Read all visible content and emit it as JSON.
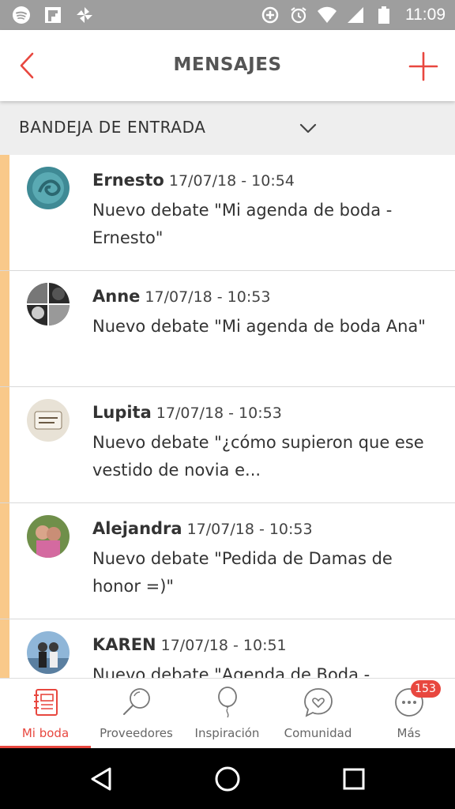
{
  "status_bar": {
    "time": "11:09",
    "left_icons": [
      "spotify-icon",
      "flipboard-icon",
      "pinwheel-icon"
    ],
    "right_icons": [
      "data-saver-icon",
      "alarm-icon",
      "wifi-icon",
      "signal-icon",
      "battery-icon"
    ]
  },
  "header": {
    "title": "MENSAJES",
    "back_icon": "chevron-left-icon",
    "add_icon": "plus-icon"
  },
  "inbox": {
    "selected": "BANDEJA DE ENTRADA"
  },
  "messages": [
    {
      "name": "Ernesto",
      "date": "17/07/18 - 10:54",
      "text": "Nuevo debate \"Mi agenda de boda - Ernesto\""
    },
    {
      "name": "Anne",
      "date": "17/07/18 - 10:53",
      "text": "Nuevo debate \"Mi agenda de boda Ana\""
    },
    {
      "name": "Lupita",
      "date": "17/07/18 - 10:53",
      "text": "Nuevo debate \"¿cómo supieron que ese vestido de novia e..."
    },
    {
      "name": "Alejandra",
      "date": "17/07/18 - 10:53",
      "text": "Nuevo debate \"Pedida de Damas de honor =)\""
    },
    {
      "name": "KAREN",
      "date": "17/07/18 - 10:51",
      "text": "Nuevo debate \"Agenda de Boda -"
    }
  ],
  "bottom_nav": {
    "items": [
      {
        "label": "Mi boda",
        "icon": "notebook-icon"
      },
      {
        "label": "Proveedores",
        "icon": "magnifier-icon"
      },
      {
        "label": "Inspiración",
        "icon": "balloon-icon"
      },
      {
        "label": "Comunidad",
        "icon": "chat-heart-icon"
      },
      {
        "label": "Más",
        "icon": "more-dots-icon"
      }
    ],
    "badge_count": "153"
  },
  "colors": {
    "accent": "#e8473f",
    "unread_marker": "#f9c98a",
    "status_bar": "#9e9e9e",
    "inbox_bar": "#eeeeee"
  }
}
